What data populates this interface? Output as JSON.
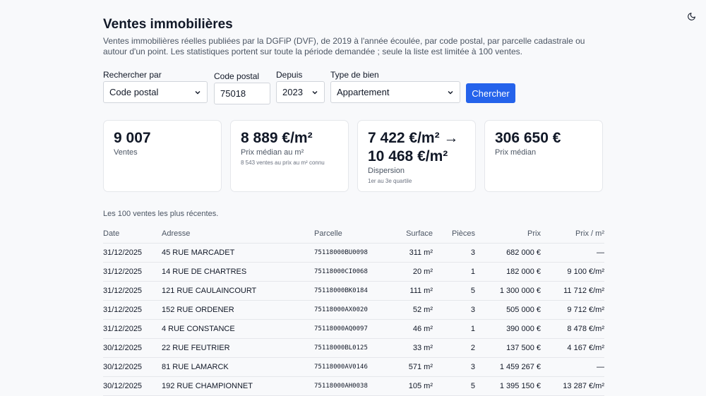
{
  "page": {
    "title": "Ventes immobilières",
    "description": "Ventes immobilières réelles publiées par la DGFiP (DVF), de 2019 à l'année écoulée, par code postal, par parcelle cadastrale ou autour d'un point. Les statistiques portent sur toute la période demandée ; seule la liste est limitée à 100 ventes."
  },
  "form": {
    "search_by": {
      "label": "Rechercher par",
      "value": "Code postal"
    },
    "postal_code": {
      "label": "Code postal",
      "value": "75018"
    },
    "since": {
      "label": "Depuis",
      "value": "2023"
    },
    "property_type": {
      "label": "Type de bien",
      "value": "Appartement"
    },
    "submit_label": "Chercher"
  },
  "stats": [
    {
      "value": "9 007",
      "label": "Ventes",
      "sub": ""
    },
    {
      "value": "8 889 €/m²",
      "label": "Prix médian au m²",
      "sub": "8 543 ventes au prix au m² connu"
    },
    {
      "value": "7 422 €/m² → 10 468 €/m²",
      "label": "Dispersion",
      "sub": "1er au 3e quartile"
    },
    {
      "value": "306 650 €",
      "label": "Prix médian",
      "sub": ""
    }
  ],
  "list": {
    "caption": "Les 100 ventes les plus récentes.",
    "columns": [
      "Date",
      "Adresse",
      "Parcelle",
      "Surface",
      "Pièces",
      "Prix",
      "Prix / m²"
    ],
    "rows": [
      [
        "31/12/2025",
        "45 RUE MARCADET",
        "75118000BU0098",
        "311 m²",
        "3",
        "682 000 €",
        "—"
      ],
      [
        "31/12/2025",
        "14 RUE DE CHARTRES",
        "75118000CI0068",
        "20 m²",
        "1",
        "182 000 €",
        "9 100 €/m²"
      ],
      [
        "31/12/2025",
        "121 RUE CAULAINCOURT",
        "75118000BK0184",
        "111 m²",
        "5",
        "1 300 000 €",
        "11 712 €/m²"
      ],
      [
        "31/12/2025",
        "152 RUE ORDENER",
        "75118000AX0020",
        "52 m²",
        "3",
        "505 000 €",
        "9 712 €/m²"
      ],
      [
        "31/12/2025",
        "4 RUE CONSTANCE",
        "75118000AQ0097",
        "46 m²",
        "1",
        "390 000 €",
        "8 478 €/m²"
      ],
      [
        "30/12/2025",
        "22 RUE FEUTRIER",
        "75118000BL0125",
        "33 m²",
        "2",
        "137 500 €",
        "4 167 €/m²"
      ],
      [
        "30/12/2025",
        "81 RUE LAMARCK",
        "75118000AV0146",
        "571 m²",
        "3",
        "1 459 267 €",
        "—"
      ],
      [
        "30/12/2025",
        "192 RUE CHAMPIONNET",
        "75118000AH0038",
        "105 m²",
        "5",
        "1 395 150 €",
        "13 287 €/m²"
      ]
    ]
  },
  "icons": {
    "theme_toggle": "moon-icon",
    "select_arrow": "chevron-down-icon",
    "range_arrow": "arrow-right-icon"
  },
  "colors": {
    "accent": "#2563eb",
    "background": "#f8f9fb",
    "card": "#ffffff",
    "text": "#111827",
    "muted": "#4b5563"
  }
}
